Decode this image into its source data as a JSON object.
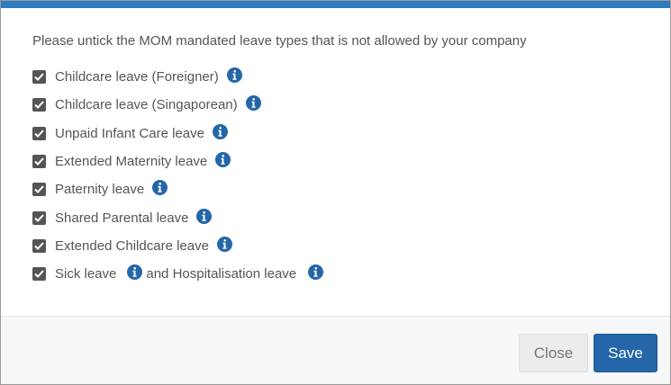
{
  "dialog": {
    "instruction": "Please untick the MOM mandated leave types that is not allowed by your company",
    "accent_color": "#2f7dc1",
    "info_icon_color": "#2466a8",
    "leave_types": [
      {
        "label": "Childcare leave (Foreigner)",
        "checked": true,
        "icon": "info-icon"
      },
      {
        "label": "Childcare leave (Singaporean)",
        "checked": true,
        "icon": "info-icon"
      },
      {
        "label": "Unpaid Infant Care leave",
        "checked": true,
        "icon": "info-icon"
      },
      {
        "label": "Extended Maternity leave",
        "checked": true,
        "icon": "info-icon"
      },
      {
        "label": "Paternity leave",
        "checked": true,
        "icon": "info-icon"
      },
      {
        "label": "Shared Parental leave",
        "checked": true,
        "icon": "info-icon"
      },
      {
        "label": "Extended Childcare leave",
        "checked": true,
        "icon": "info-icon"
      }
    ],
    "sick_leave": {
      "label_part1": "Sick leave",
      "label_part2": "and Hospitalisation leave",
      "checked": true,
      "icon": "info-icon"
    },
    "footer": {
      "close_label": "Close",
      "save_label": "Save"
    }
  }
}
